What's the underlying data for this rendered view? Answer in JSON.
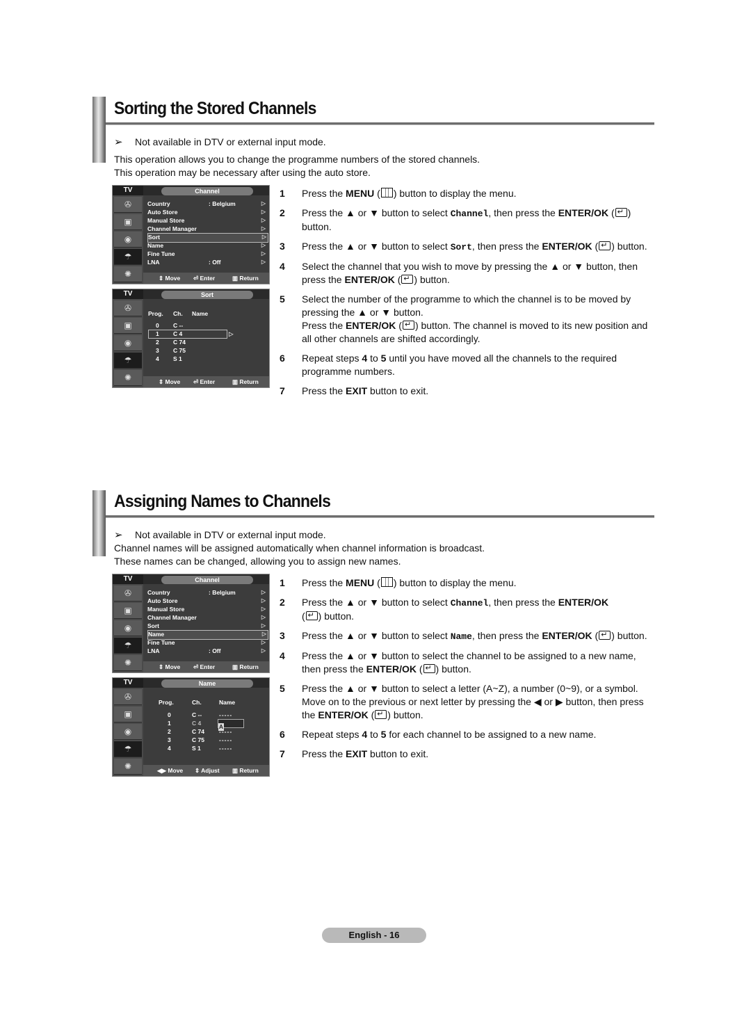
{
  "sections": [
    {
      "title": "Sorting the Stored Channels",
      "note": "Not available in DTV or external input mode.",
      "intro": [
        "This operation allows you to change the programme numbers of the stored channels.",
        "This operation may be necessary after using the auto store."
      ],
      "menu_osd": {
        "tv_label": "TV",
        "title": "Channel",
        "items": [
          {
            "label": "Country",
            "value": ": Belgium"
          },
          {
            "label": "Auto Store",
            "value": ""
          },
          {
            "label": "Manual Store",
            "value": ""
          },
          {
            "label": "Channel Manager",
            "value": ""
          },
          {
            "label": "Sort",
            "value": "",
            "selected": true
          },
          {
            "label": "Name",
            "value": ""
          },
          {
            "label": "Fine Tune",
            "value": ""
          },
          {
            "label": "LNA",
            "value": ": Off"
          }
        ],
        "footer": {
          "move": "Move",
          "enter": "Enter",
          "return": "Return"
        }
      },
      "sort_osd": {
        "tv_label": "TV",
        "title": "Sort",
        "headers": [
          "Prog.",
          "Ch.",
          "Name"
        ],
        "rows": [
          {
            "prog": "0",
            "ch": "C --"
          },
          {
            "prog": "1",
            "ch": "C 4",
            "selected": true
          },
          {
            "prog": "2",
            "ch": "C 74"
          },
          {
            "prog": "3",
            "ch": "C 75"
          },
          {
            "prog": "4",
            "ch": "S 1"
          }
        ],
        "footer": {
          "move": "Move",
          "enter": "Enter",
          "return": "Return"
        }
      },
      "steps": [
        {
          "num": "1",
          "html": "Press the <b>MENU</b> (<span class='menu-ic' data-name='menu-button-icon'></span>) button to display the menu."
        },
        {
          "num": "2",
          "html": "Press the ▲ or ▼ button to select <span class='mono'>Channel</span>, then press the <b>ENTER/OK</b> (<span class='enter-ic' data-name='enter-button-icon'></span>) button."
        },
        {
          "num": "3",
          "html": "Press the ▲ or ▼ button to select <span class='mono'>Sort</span>, then press the <b>ENTER/OK</b> (<span class='enter-ic' data-name='enter-button-icon'></span>) button."
        },
        {
          "num": "4",
          "html": "Select the channel that you wish to move by pressing the ▲ or ▼ button, then press the <b>ENTER/OK</b> (<span class='enter-ic' data-name='enter-button-icon'></span>) button."
        },
        {
          "num": "5",
          "html": "Select the number of the programme to which the channel is to be moved by pressing the ▲ or ▼ button.<br>Press the <b>ENTER/OK</b> (<span class='enter-ic' data-name='enter-button-icon'></span>) button. The channel is moved to its new position and all other channels are shifted accordingly."
        },
        {
          "num": "6",
          "html": "Repeat steps <b>4</b> to <b>5</b> until you have moved all the channels to the required programme numbers."
        },
        {
          "num": "7",
          "html": "Press the <b>EXIT</b> button to exit."
        }
      ]
    },
    {
      "title": "Assigning Names to Channels",
      "note": "Not available in DTV or external input mode.",
      "intro": [
        "Channel names will be assigned automatically when channel information is broadcast.",
        "These names can be changed, allowing you to assign new names."
      ],
      "menu_osd": {
        "tv_label": "TV",
        "title": "Channel",
        "items": [
          {
            "label": "Country",
            "value": ": Belgium"
          },
          {
            "label": "Auto Store",
            "value": ""
          },
          {
            "label": "Manual Store",
            "value": ""
          },
          {
            "label": "Channel Manager",
            "value": ""
          },
          {
            "label": "Sort",
            "value": ""
          },
          {
            "label": "Name",
            "value": "",
            "selected": true
          },
          {
            "label": "Fine Tune",
            "value": ""
          },
          {
            "label": "LNA",
            "value": ": Off"
          }
        ],
        "footer": {
          "move": "Move",
          "enter": "Enter",
          "return": "Return"
        }
      },
      "name_osd": {
        "tv_label": "TV",
        "title": "Name",
        "headers": [
          "Prog.",
          "Ch.",
          "Name"
        ],
        "rows": [
          {
            "prog": "0",
            "ch": "C --",
            "name": "-----"
          },
          {
            "prog": "1",
            "ch": "C 4",
            "name": "A",
            "selected": true
          },
          {
            "prog": "2",
            "ch": "C 74",
            "name": "-----"
          },
          {
            "prog": "3",
            "ch": "C 75",
            "name": "-----"
          },
          {
            "prog": "4",
            "ch": "S 1",
            "name": "-----"
          }
        ],
        "footer": {
          "move": "Move",
          "adjust": "Adjust",
          "return": "Return"
        }
      },
      "steps": [
        {
          "num": "1",
          "html": "Press the <b>MENU</b> (<span class='menu-ic' data-name='menu-button-icon'></span>) button to display the menu."
        },
        {
          "num": "2",
          "html": "Press the ▲ or ▼ button to select <span class='mono'>Channel</span>, then press the <b>ENTER/OK</b><br>(<span class='enter-ic' data-name='enter-button-icon'></span>) button."
        },
        {
          "num": "3",
          "html": "Press the ▲ or ▼ button to select <span class='mono'>Name</span>, then press the <b>ENTER/OK</b> (<span class='enter-ic' data-name='enter-button-icon'></span>) button."
        },
        {
          "num": "4",
          "html": "Press the ▲ or ▼ button to select the channel to be assigned to a new name, then press the <b>ENTER/OK</b> (<span class='enter-ic' data-name='enter-button-icon'></span>) button."
        },
        {
          "num": "5",
          "html": "Press the ▲ or ▼ button to select a letter (A~Z), a number (0~9), or a symbol. Move on to the previous or next letter by pressing the ◀ or ▶ button, then press the <b>ENTER/OK</b> (<span class='enter-ic' data-name='enter-button-icon'></span>) button."
        },
        {
          "num": "6",
          "html": "Repeat steps <b>4</b> to <b>5</b> for each channel to be assigned to a new name."
        },
        {
          "num": "7",
          "html": "Press the <b>EXIT</b> button to exit."
        }
      ]
    }
  ],
  "footer": {
    "page_label": "English - 16"
  }
}
